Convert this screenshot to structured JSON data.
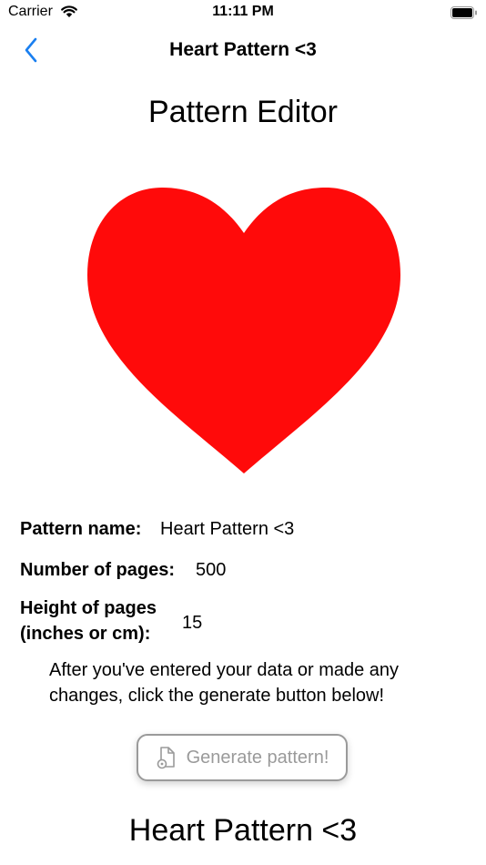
{
  "status_bar": {
    "carrier": "Carrier",
    "time": "11:11 PM",
    "wifi_icon": "wifi-icon",
    "battery_icon": "battery-icon"
  },
  "nav": {
    "back_icon": "chevron-left-icon",
    "title": "Heart Pattern <3",
    "accent_color": "#1a7ff0"
  },
  "main": {
    "title": "Pattern Editor",
    "heart_color": "#ff0a0a",
    "fields": {
      "pattern_name_label": "Pattern name:",
      "pattern_name_value": "Heart Pattern <3",
      "pages_label": "Number of pages:",
      "pages_value": "500",
      "height_label_line1": "Height of pages",
      "height_label_line2": "(inches or cm):",
      "height_value": "15"
    },
    "instructions": "After you've entered your data or made any changes, click the generate button below!",
    "generate_button": {
      "label": "Generate pattern!",
      "icon": "document-gear-icon"
    },
    "result_title": "Heart Pattern <3"
  }
}
